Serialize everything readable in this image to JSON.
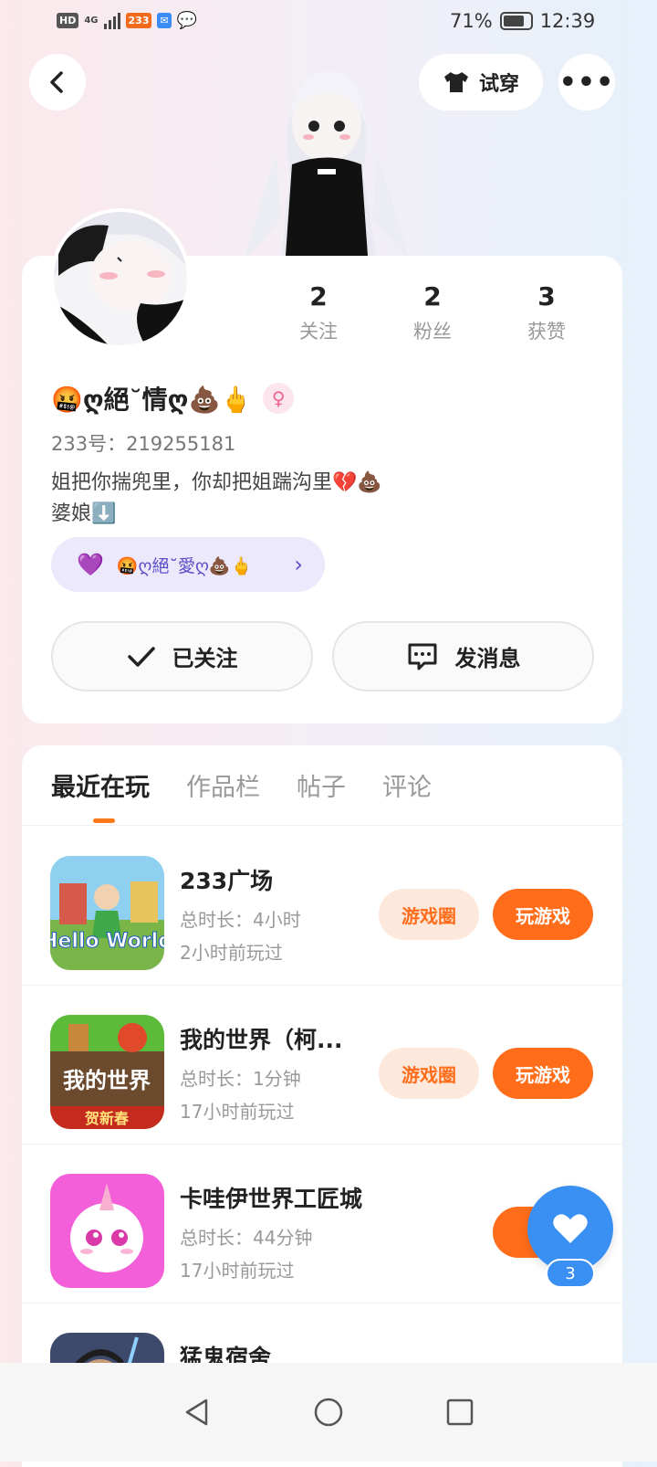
{
  "status_bar": {
    "hd": "HD",
    "network": "4G",
    "badge_233": "233",
    "battery": "71%",
    "time": "12:39"
  },
  "header": {
    "try_on_label": "试穿",
    "more_label": "•••"
  },
  "profile": {
    "stats": [
      {
        "value": "2",
        "label": "关注"
      },
      {
        "value": "2",
        "label": "粉丝"
      },
      {
        "value": "3",
        "label": "获赞"
      }
    ],
    "nickname": "🤬ღ絕˘情ღ💩🖕",
    "gender_symbol": "♀",
    "uid": "233号：219255181",
    "bio_line1": "姐把你揣兜里，你却把姐踹沟里💔💩",
    "bio_line2": "婆娘⬇️",
    "cp_name": "🤬ღ絕˘愛ღ💩🖕",
    "follow_label": "已关注",
    "message_label": "发消息"
  },
  "tabs": [
    "最近在玩",
    "作品栏",
    "帖子",
    "评论"
  ],
  "games": [
    {
      "name": "233广场",
      "duration": "总时长：4小时",
      "last_played": "2小时前玩过",
      "circle_label": "游戏圈",
      "play_label": "玩游戏",
      "icon_text": "Hello World"
    },
    {
      "name": "我的世界（柯...",
      "duration": "总时长：1分钟",
      "last_played": "17小时前玩过",
      "circle_label": "游戏圈",
      "play_label": "玩游戏",
      "icon_text": "我的世界",
      "icon_sub": "贺新春"
    },
    {
      "name": "卡哇伊世界工匠城",
      "duration": "总时长：44分钟",
      "last_played": "17小时前玩过",
      "circle_label": "",
      "play_label": "玩",
      "icon_text": ""
    },
    {
      "name": "猛鬼宿舍",
      "duration": "",
      "last_played": "",
      "circle_label": "",
      "play_label": "",
      "icon_text": ""
    }
  ],
  "fab": {
    "count": "3"
  },
  "colors": {
    "accent": "#ff6d1a",
    "fab": "#3a8ff3"
  }
}
